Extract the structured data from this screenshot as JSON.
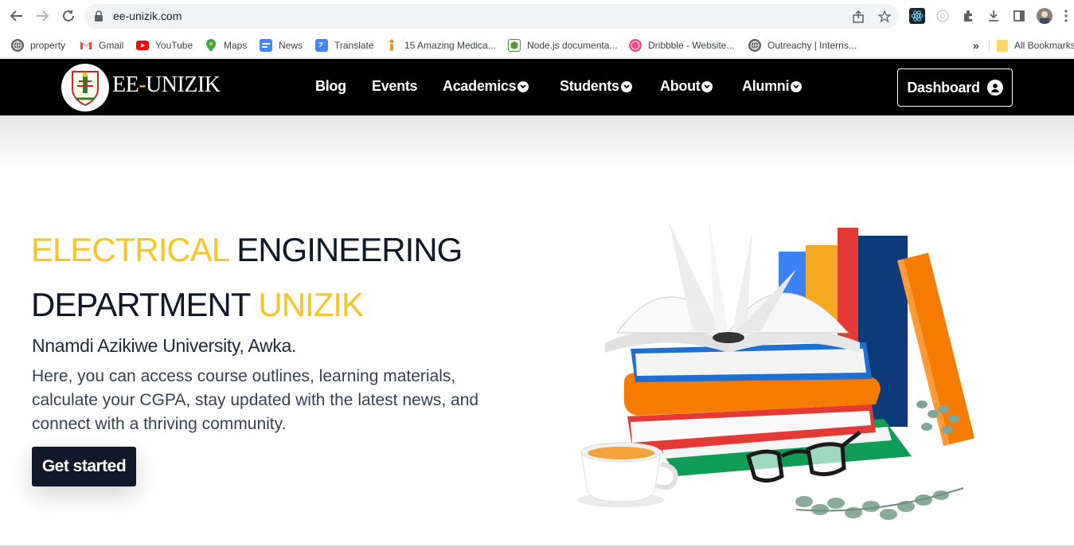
{
  "browser": {
    "url": "ee-unizik.com",
    "bookmarks": [
      {
        "label": "property",
        "icon": "globe-icon"
      },
      {
        "label": "Gmail",
        "icon": "gmail-icon"
      },
      {
        "label": "YouTube",
        "icon": "youtube-icon"
      },
      {
        "label": "Maps",
        "icon": "maps-icon"
      },
      {
        "label": "News",
        "icon": "news-icon"
      },
      {
        "label": "Translate",
        "icon": "translate-icon"
      },
      {
        "label": "15 Amazing Medica...",
        "icon": "medical-icon"
      },
      {
        "label": "Node.js documenta...",
        "icon": "node-icon"
      },
      {
        "label": "Dribbble - Website...",
        "icon": "dribbble-icon"
      },
      {
        "label": "Outreachy | Interns...",
        "icon": "globe-icon"
      }
    ],
    "overflow": "»",
    "all_bookmarks": "All Bookmarks"
  },
  "site": {
    "brand_left": "EE",
    "brand_dash": "-",
    "brand_right": "UNIZIK",
    "nav": [
      {
        "label": "Blog",
        "dropdown": false
      },
      {
        "label": "Events",
        "dropdown": false
      },
      {
        "label": "Academics",
        "dropdown": true
      },
      {
        "label": "Students",
        "dropdown": true
      },
      {
        "label": "About",
        "dropdown": true
      },
      {
        "label": "Alumni",
        "dropdown": true
      }
    ],
    "dashboard_label": "Dashboard"
  },
  "hero": {
    "line1_accent": "ELECTRICAL",
    "line1_rest": " ENGINEERING",
    "line2_rest": "DEPARTMENT ",
    "line2_accent": "UNIZIK",
    "subtitle": "Nnamdi Azikiwe University, Awka.",
    "paragraph": "Here, you can access course outlines, learning materials, calculate your CGPA, stay updated with the latest news, and connect with a thriving community.",
    "cta_label": "Get started"
  },
  "colors": {
    "accent": "#f7c52a",
    "header_bg": "#000000",
    "dark": "#111827"
  }
}
